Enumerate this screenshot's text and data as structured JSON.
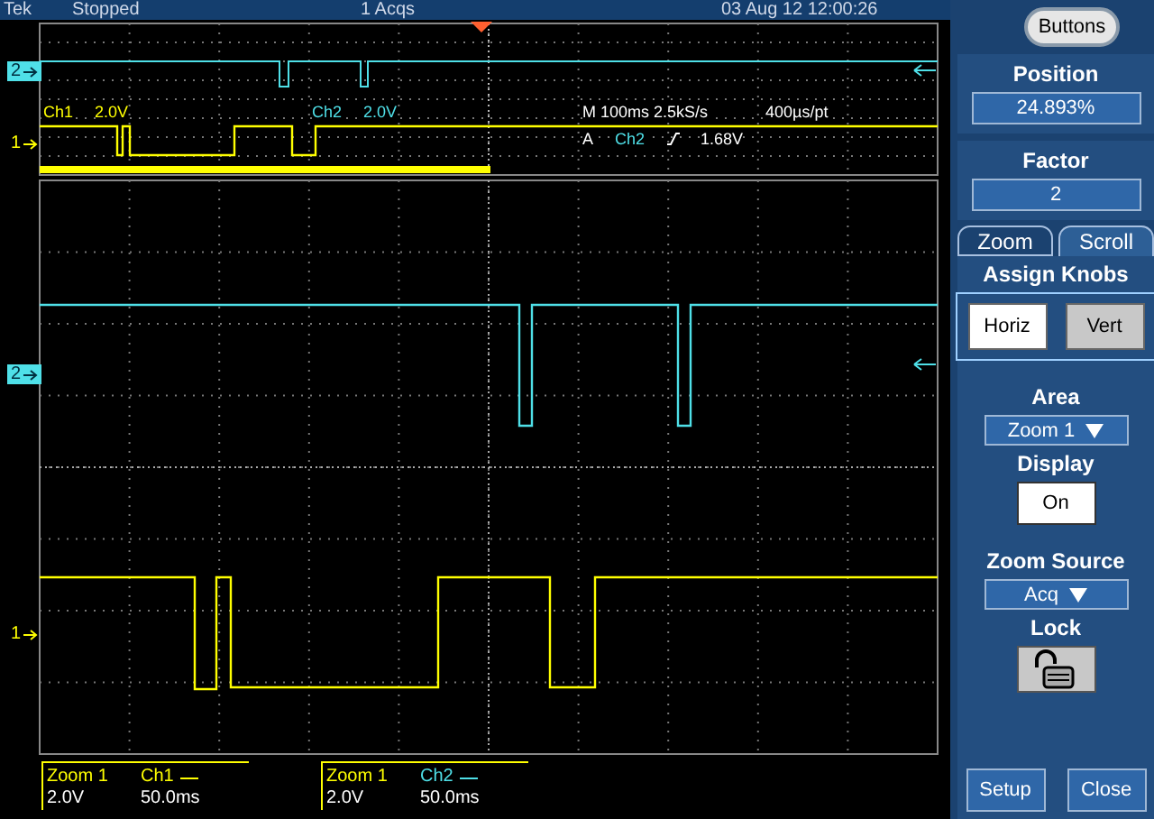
{
  "status_bar": {
    "brand": "Tek",
    "state": "Stopped",
    "acquisitions": "1 Acqs",
    "datetime": "03 Aug 12 12:00:26"
  },
  "overview": {
    "markers": [
      {
        "label": "2",
        "selected": true
      },
      {
        "label": "1",
        "selected": false
      }
    ],
    "ch1_label": "Ch1",
    "ch1_scale": "2.0V",
    "ch2_label": "Ch2",
    "ch2_scale": "2.0V",
    "timebase": "M 100ms 2.5kS/s",
    "resolution": "400µs/pt",
    "trigger_source": "A",
    "trigger_channel": "Ch2",
    "trigger_level": "1.68V"
  },
  "zoom_view": {
    "markers": [
      {
        "label": "2",
        "selected": true
      },
      {
        "label": "1",
        "selected": false
      }
    ]
  },
  "readouts": [
    {
      "title": "Zoom 1",
      "channel": "Ch1",
      "color": "#ffff00",
      "scale": "2.0V",
      "time": "50.0ms"
    },
    {
      "title": "Zoom 1",
      "channel": "Ch2",
      "color": "#4fe0e8",
      "scale": "2.0V",
      "time": "50.0ms"
    }
  ],
  "panel": {
    "top_button": "Buttons",
    "position": {
      "label": "Position",
      "value": "24.893%"
    },
    "factor": {
      "label": "Factor",
      "value": "2"
    },
    "tabs": [
      {
        "label": "Zoom",
        "selected": false
      },
      {
        "label": "Scroll",
        "selected": true
      }
    ],
    "assign_knobs": {
      "title": "Assign Knobs",
      "options": [
        {
          "label": "Horiz",
          "selected": true
        },
        {
          "label": "Vert",
          "selected": false
        }
      ]
    },
    "area": {
      "label": "Area",
      "value": "Zoom 1"
    },
    "display": {
      "label": "Display",
      "value": "On"
    },
    "zoom_source": {
      "label": "Zoom Source",
      "value": "Acq"
    },
    "lock": {
      "label": "Lock",
      "locked": false
    },
    "buttons": [
      "Setup",
      "Close"
    ]
  }
}
